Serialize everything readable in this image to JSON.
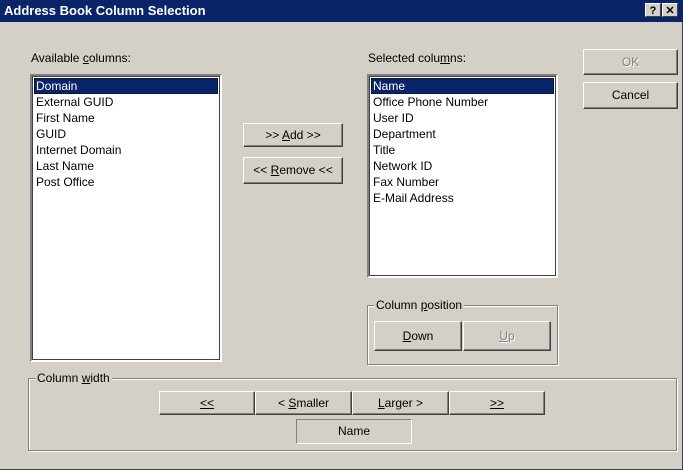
{
  "window": {
    "title": "Address Book Column Selection",
    "help_icon": "?",
    "close_icon": "✕"
  },
  "available": {
    "label_pre": "Available ",
    "label_key": "c",
    "label_post": "olumns:",
    "items": [
      "Domain",
      "External GUID",
      "First Name",
      "GUID",
      "Internet Domain",
      "Last Name",
      "Post Office"
    ]
  },
  "selected": {
    "label_pre": "Selected colu",
    "label_key": "m",
    "label_post": "ns:",
    "items": [
      "Name",
      "Office Phone Number",
      "User ID",
      "Department",
      "Title",
      "Network ID",
      "Fax Number",
      "E-Mail Address"
    ]
  },
  "buttons": {
    "ok": "OK",
    "cancel": "Cancel",
    "add_pre": ">> ",
    "add_key": "A",
    "add_post": "dd >>",
    "remove_pre": "<< ",
    "remove_key": "R",
    "remove_post": "emove <<"
  },
  "column_position": {
    "label_pre": "Column ",
    "label_key": "p",
    "label_post": "osition",
    "down_key": "D",
    "down_post": "own",
    "up_key": "U",
    "up_post": "p"
  },
  "column_width": {
    "label_pre": "Column ",
    "label_key": "w",
    "label_post": "idth",
    "far_left": "<<",
    "smaller_pre": "< ",
    "smaller_key": "S",
    "smaller_post": "maller",
    "larger_key": "L",
    "larger_post": "arger >",
    "far_right": ">>",
    "current_column": "Name"
  }
}
